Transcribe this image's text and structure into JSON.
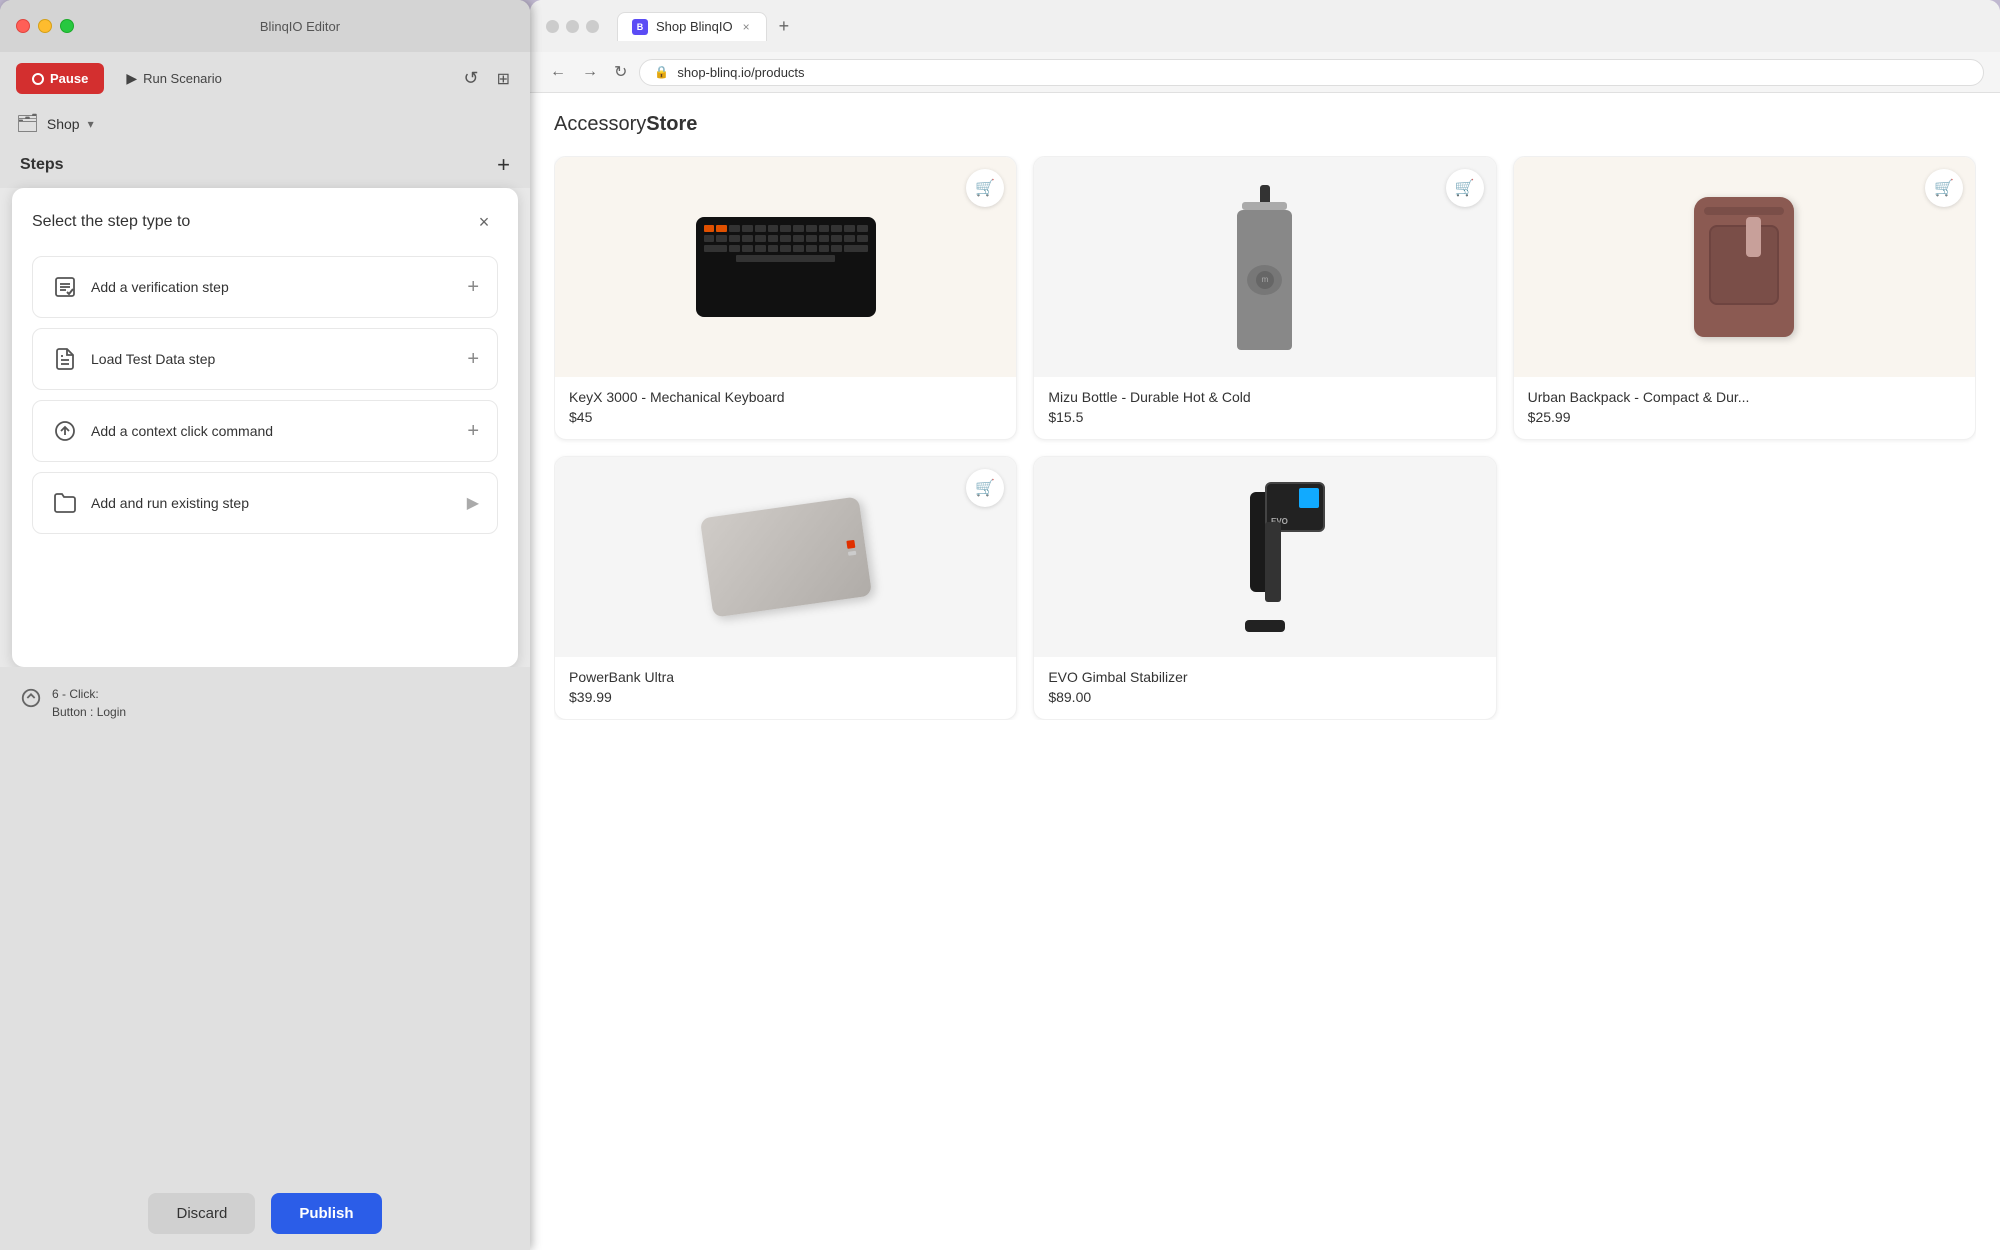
{
  "editor": {
    "title": "BlinqIO Editor",
    "toolbar": {
      "pause_label": "Pause",
      "run_label": "Run Scenario",
      "shop_label": "Shop"
    },
    "steps": {
      "title": "Steps"
    },
    "step_selector": {
      "title": "Select the step type to",
      "options": [
        {
          "id": "verification",
          "label": "Add a verification step",
          "icon": "✓☰"
        },
        {
          "id": "load-test",
          "label": "Load Test Data step",
          "icon": "📄"
        },
        {
          "id": "context-click",
          "label": "Add a context click command",
          "icon": "↻"
        },
        {
          "id": "existing",
          "label": "Add and run existing step",
          "icon": "📁"
        }
      ]
    },
    "step_history": {
      "item": {
        "number": "6 - Click:",
        "detail": "Button : Login"
      }
    },
    "actions": {
      "discard_label": "Discard",
      "publish_label": "Publish"
    }
  },
  "browser": {
    "tab_title": "Shop BlinqIO",
    "url": "shop-blinq.io/products",
    "store_name_part1": "Accessory",
    "store_name_part2": "Store",
    "products": [
      {
        "id": 1,
        "name": "KeyX 3000 - Mechanical Keyboard",
        "price": "$45",
        "bg": "cream"
      },
      {
        "id": 2,
        "name": "Mizu Bottle - Durable Hot & Cold",
        "price": "$15.5",
        "bg": "light"
      },
      {
        "id": 3,
        "name": "Urban Backpack - Compact & Dur...",
        "price": "$25.99",
        "bg": "cream"
      },
      {
        "id": 4,
        "name": "PowerBank Ultra",
        "price": "$39.99",
        "bg": "light"
      },
      {
        "id": 5,
        "name": "EVO Gimbal Stabilizer",
        "price": "$89.00",
        "bg": "light"
      }
    ]
  },
  "icons": {
    "pause": "⏸",
    "play": "▶",
    "refresh": "↺",
    "layout": "⊞",
    "folder": "🗂",
    "chevron": "▾",
    "plus": "+",
    "close": "×",
    "cart": "🛒",
    "back": "←",
    "forward": "→",
    "reload": "↻",
    "lock": "🔒",
    "new_tab": "+"
  }
}
